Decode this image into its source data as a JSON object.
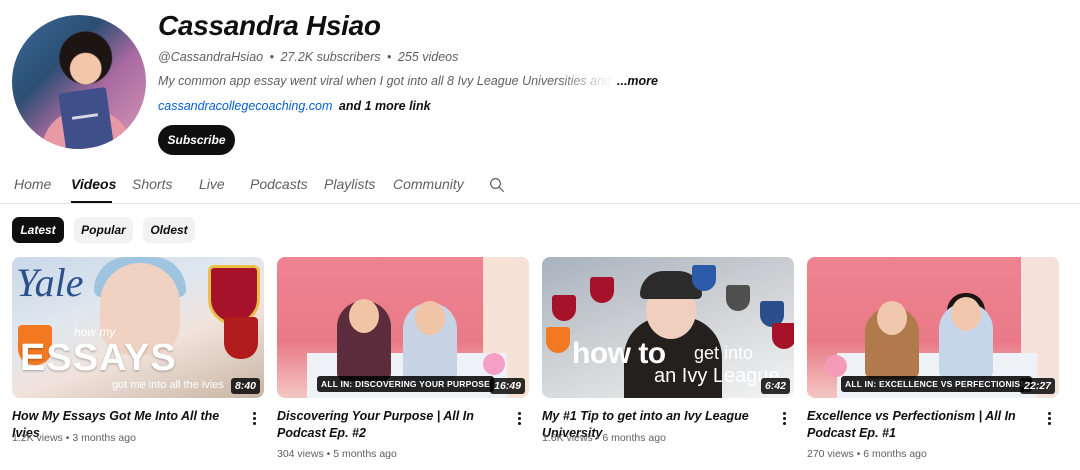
{
  "channel": {
    "name": "Cassandra Hsiao",
    "handle": "@CassandraHsiao",
    "subscribers": "27.2K subscribers",
    "videos": "255 videos",
    "description": "My common app essay went viral when I got into all 8 Ivy League Universities and every oth",
    "more": "...more",
    "link": "cassandracollegecoaching.com",
    "more_links": "and 1 more link",
    "subscribe_label": "Subscribe",
    "meta_separator": "•"
  },
  "tabs": [
    "Home",
    "Videos",
    "Shorts",
    "Live",
    "Podcasts",
    "Playlists",
    "Community"
  ],
  "active_tab": "Videos",
  "chips": [
    "Latest",
    "Popular",
    "Oldest"
  ],
  "active_chip": "Latest",
  "videos": [
    {
      "title": "How My Essays Got Me Into All the Ivies",
      "views": "1.2K views",
      "age": "3 months ago",
      "duration": "8:40",
      "thumb_text": {
        "yale": "Yale",
        "big": "ESSAYS",
        "small": "got me into all the ivies",
        "small2": "how my"
      }
    },
    {
      "title": "Discovering Your Purpose | All In Podcast Ep. #2",
      "views": "304 views",
      "age": "5 months ago",
      "duration": "16:49",
      "thumb_label": "ALL IN: DISCOVERING YOUR PURPOSE"
    },
    {
      "title": "My #1 Tip to get into an Ivy League University",
      "views": "1.6K views",
      "age": "6 months ago",
      "duration": "6:42",
      "thumb_text": {
        "how": "how to",
        "rest": "get into",
        "rest2": "an Ivy League"
      }
    },
    {
      "title": "Excellence vs Perfectionism | All In Podcast Ep. #1",
      "views": "270 views",
      "age": "6 months ago",
      "duration": "22:27",
      "thumb_label": "ALL IN: EXCELLENCE VS PERFECTIONISM"
    }
  ],
  "stat_separator": "•",
  "icons": {
    "search": "search-icon",
    "more": "more-vert-icon"
  },
  "colors": {
    "link": "#065fd4",
    "subscribe_bg": "#0f0f0f",
    "meta": "#606060"
  }
}
